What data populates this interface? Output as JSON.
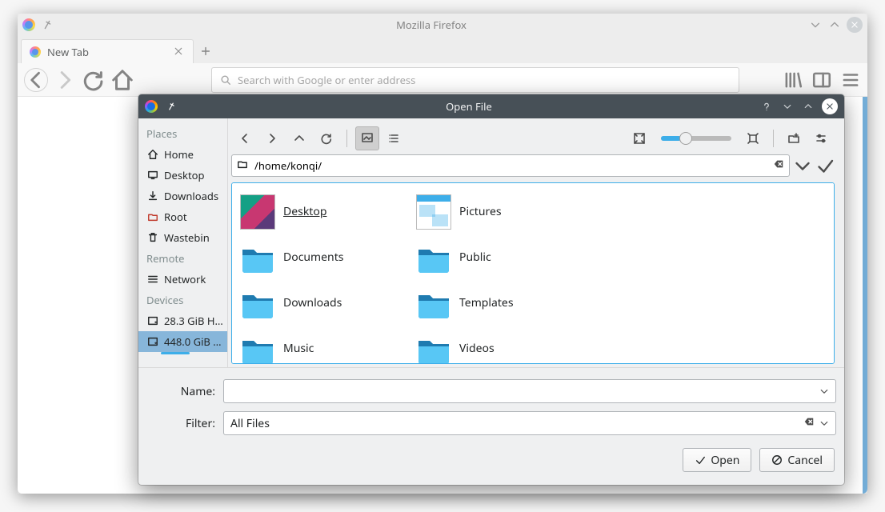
{
  "firefox": {
    "window_title": "Mozilla Firefox",
    "tab_title": "New Tab",
    "url_placeholder": "Search with Google or enter address"
  },
  "dialog": {
    "title": "Open File",
    "path": "/home/konqi/",
    "name_label": "Name:",
    "name_value": "",
    "filter_label": "Filter:",
    "filter_value": "All Files",
    "open_button": "Open",
    "cancel_button": "Cancel",
    "sidebar": {
      "places_header": "Places",
      "remote_header": "Remote",
      "devices_header": "Devices",
      "places": [
        {
          "label": "Home"
        },
        {
          "label": "Desktop"
        },
        {
          "label": "Downloads"
        },
        {
          "label": "Root"
        },
        {
          "label": "Wastebin"
        }
      ],
      "remote": [
        {
          "label": "Network"
        }
      ],
      "devices": [
        {
          "label": "28.3 GiB H…"
        },
        {
          "label": "448.0 GiB …"
        }
      ]
    },
    "files": [
      {
        "name": "Desktop",
        "kind": "thumb-desktop",
        "selected": true
      },
      {
        "name": "Pictures",
        "kind": "thumb-pictures"
      },
      {
        "name": "Documents",
        "kind": "folder"
      },
      {
        "name": "Public",
        "kind": "folder"
      },
      {
        "name": "Downloads",
        "kind": "folder"
      },
      {
        "name": "Templates",
        "kind": "folder"
      },
      {
        "name": "Music",
        "kind": "folder"
      },
      {
        "name": "Videos",
        "kind": "folder"
      }
    ]
  }
}
